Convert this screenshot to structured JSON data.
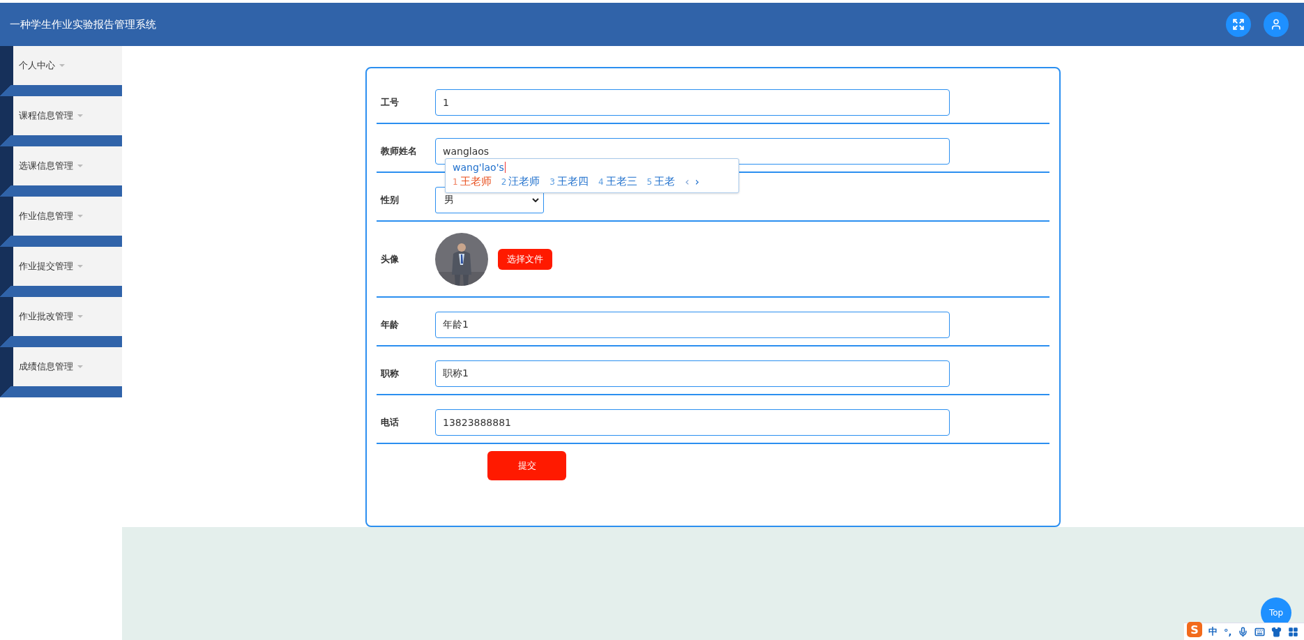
{
  "header": {
    "title": "一种学生作业实验报告管理系统"
  },
  "sidebar": {
    "items": [
      {
        "label": "个人中心"
      },
      {
        "label": "课程信息管理"
      },
      {
        "label": "选课信息管理"
      },
      {
        "label": "作业信息管理"
      },
      {
        "label": "作业提交管理"
      },
      {
        "label": "作业批改管理"
      },
      {
        "label": "成绩信息管理"
      }
    ]
  },
  "form": {
    "fields": [
      {
        "kind": "text",
        "label": "工号",
        "value": "1"
      },
      {
        "kind": "text",
        "label": "教师姓名",
        "value": "wanglaos",
        "ime": {
          "composition": "wang'lao's",
          "candidates": [
            {
              "index": "1",
              "text": "王老师",
              "selected": true
            },
            {
              "index": "2",
              "text": "汪老师",
              "selected": false
            },
            {
              "index": "3",
              "text": "王老四",
              "selected": false
            },
            {
              "index": "4",
              "text": "王老三",
              "selected": false
            },
            {
              "index": "5",
              "text": "王老",
              "selected": false
            }
          ],
          "prev": "‹",
          "next": "›"
        }
      },
      {
        "kind": "select",
        "label": "性别",
        "value": "男"
      },
      {
        "label": "头像",
        "button": "选择文件"
      },
      {
        "kind": "text",
        "label": "年龄",
        "value": "年龄1"
      },
      {
        "kind": "text",
        "label": "职称",
        "value": "职称1"
      },
      {
        "kind": "text",
        "label": "电话",
        "value": "13823888881"
      }
    ],
    "submit": "提交"
  },
  "top_button": "Top",
  "ime_toolbar": {
    "logo": "S",
    "mode": "中",
    "punctuation": "°,"
  }
}
